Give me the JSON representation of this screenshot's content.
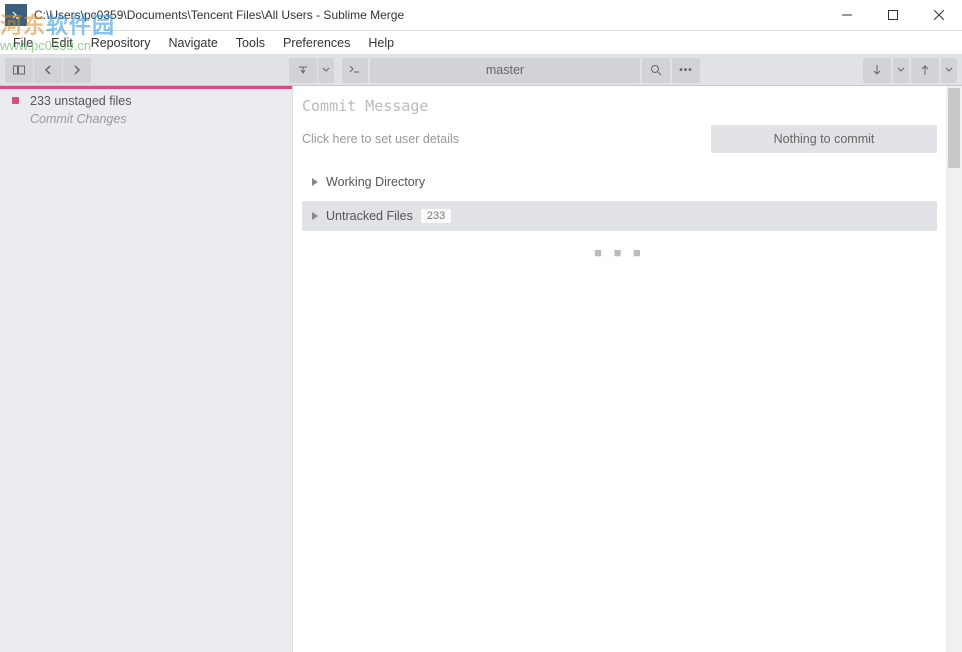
{
  "window": {
    "title": "C:\\Users\\pc0359\\Documents\\Tencent Files\\All Users - Sublime Merge"
  },
  "menu": {
    "file": "File",
    "edit": "Edit",
    "repository": "Repository",
    "navigate": "Navigate",
    "tools": "Tools",
    "preferences": "Preferences",
    "help": "Help"
  },
  "toolbar": {
    "branch": "master"
  },
  "sidebar": {
    "unstaged": "233 unstaged files",
    "commit_changes": "Commit Changes"
  },
  "content": {
    "commit_message_label": "Commit Message",
    "user_details": "Click here to set user details",
    "commit_button": "Nothing to commit",
    "working_directory": "Working Directory",
    "untracked_files": "Untracked Files",
    "untracked_count": "233"
  },
  "watermark": {
    "brand": "河东软件园",
    "url": "www.pc0359.cn"
  }
}
